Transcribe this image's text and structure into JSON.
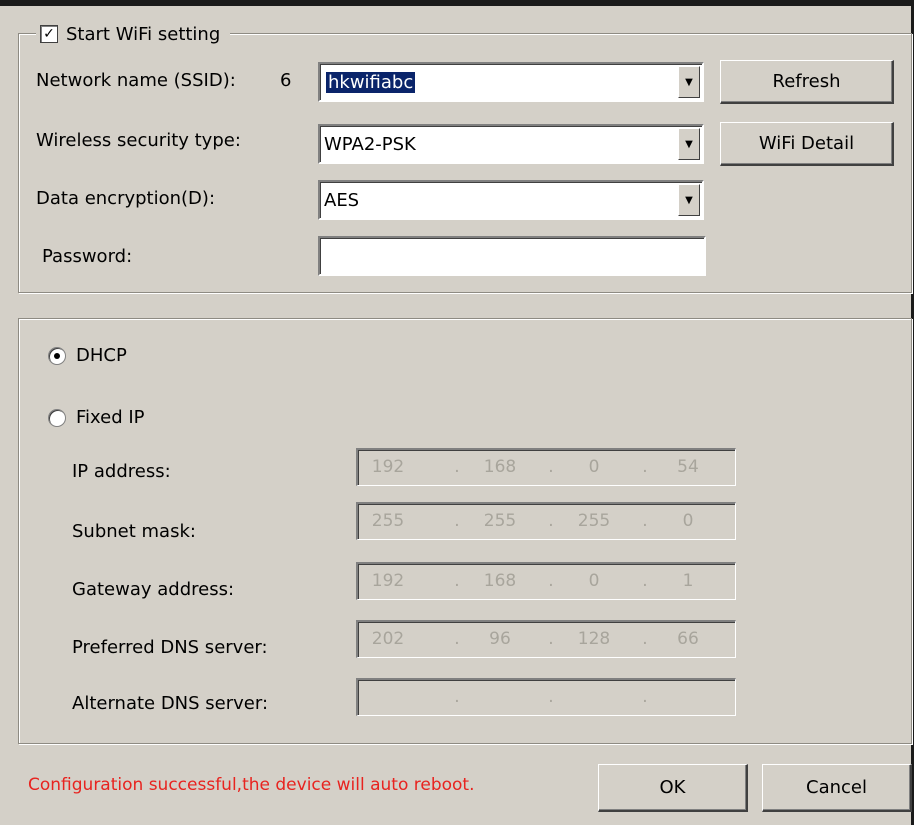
{
  "wifi_group": {
    "legend": "Start WiFi setting",
    "checked": true,
    "ssid_label": "Network name (SSID):",
    "ssid_count": "6",
    "ssid_value": "hkwifiabc",
    "security_label": "Wireless security type:",
    "security_value": "WPA2-PSK",
    "encryption_label": "Data encryption(D):",
    "encryption_value": "AES",
    "password_label": "Password:",
    "password_value": "",
    "refresh_label": "Refresh",
    "detail_label": "WiFi Detail"
  },
  "ip_group": {
    "dhcp_label": "DHCP",
    "fixed_label": "Fixed IP",
    "selected": "DHCP",
    "rows": [
      {
        "label": "IP address:",
        "octets": [
          "192",
          "168",
          "0",
          "54"
        ]
      },
      {
        "label": "Subnet mask:",
        "octets": [
          "255",
          "255",
          "255",
          "0"
        ]
      },
      {
        "label": "Gateway address:",
        "octets": [
          "192",
          "168",
          "0",
          "1"
        ]
      },
      {
        "label": "Preferred DNS server:",
        "octets": [
          "202",
          "96",
          "128",
          "66"
        ]
      },
      {
        "label": "Alternate DNS server:",
        "octets": [
          "",
          "",
          "",
          ""
        ]
      }
    ],
    "separator": "."
  },
  "footer": {
    "status": "Configuration successful,the device will auto reboot.",
    "ok_label": "OK",
    "cancel_label": "Cancel"
  },
  "colors": {
    "status_text": "#e8231f",
    "selection": "#0a246a",
    "face": "#d4d0c8"
  }
}
